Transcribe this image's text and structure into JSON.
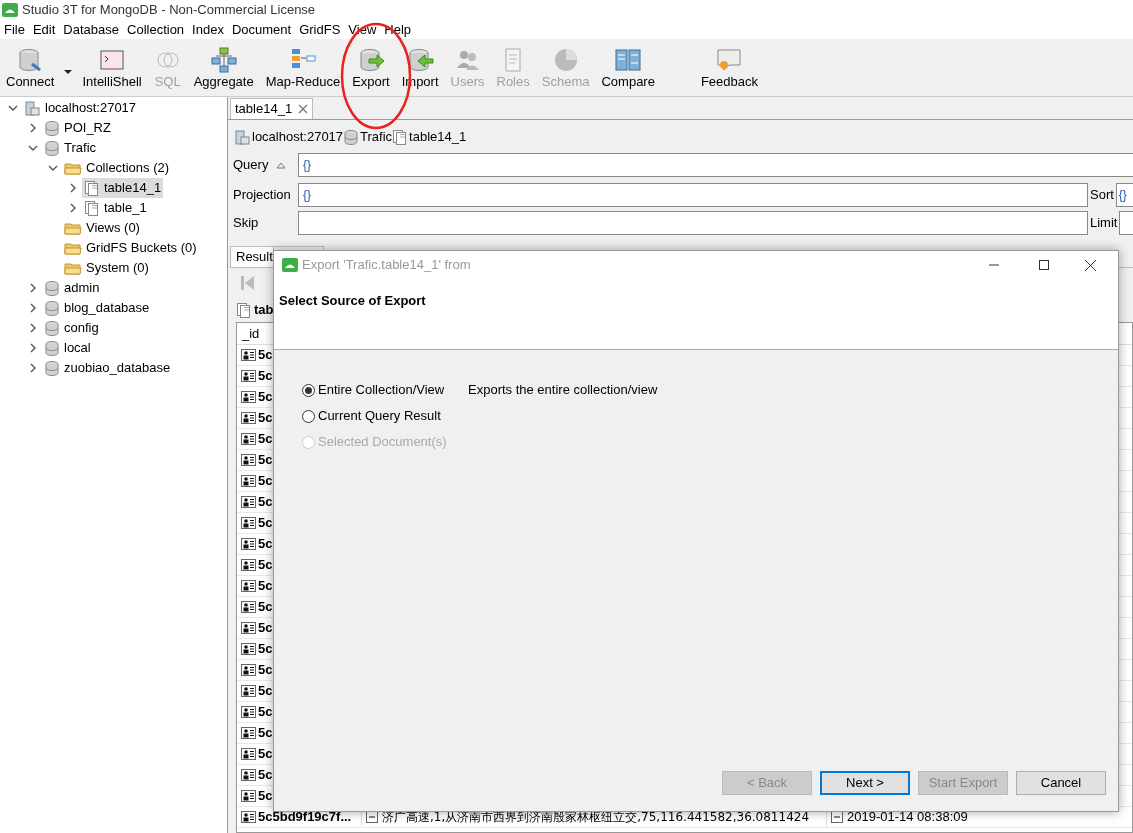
{
  "window": {
    "title": "Studio 3T for MongoDB - Non-Commercial License"
  },
  "menu": [
    "File",
    "Edit",
    "Database",
    "Collection",
    "Index",
    "Document",
    "GridFS",
    "View",
    "Help"
  ],
  "toolbar": [
    {
      "kind": "connect",
      "label": "Connect",
      "disabled": false,
      "dropdown": true
    },
    {
      "kind": "shell",
      "label": "IntelliShell",
      "disabled": false,
      "dropdown": false
    },
    {
      "kind": "sql",
      "label": "SQL",
      "disabled": true,
      "dropdown": false
    },
    {
      "kind": "aggregate",
      "label": "Aggregate",
      "disabled": false,
      "dropdown": false
    },
    {
      "kind": "mapreduce",
      "label": "Map-Reduce",
      "disabled": false,
      "dropdown": false
    },
    {
      "kind": "export",
      "label": "Export",
      "disabled": false,
      "dropdown": false
    },
    {
      "kind": "import",
      "label": "Import",
      "disabled": false,
      "dropdown": false
    },
    {
      "kind": "users",
      "label": "Users",
      "disabled": true,
      "dropdown": false
    },
    {
      "kind": "roles",
      "label": "Roles",
      "disabled": true,
      "dropdown": false
    },
    {
      "kind": "schema",
      "label": "Schema",
      "disabled": true,
      "dropdown": false
    },
    {
      "kind": "compare",
      "label": "Compare",
      "disabled": false,
      "dropdown": false
    },
    {
      "kind": "feedback",
      "label": "Feedback",
      "disabled": false,
      "dropdown": false
    }
  ],
  "tree": [
    {
      "kind": "server",
      "label": "localhost:27017",
      "expandable": true,
      "expanded": true,
      "selected": false,
      "children": [
        {
          "kind": "database",
          "label": "POI_RZ",
          "expandable": true,
          "expanded": false,
          "selected": false
        },
        {
          "kind": "database",
          "label": "Trafic",
          "expandable": true,
          "expanded": true,
          "selected": false,
          "children": [
            {
              "kind": "folder",
              "label": "Collections (2)",
              "expandable": true,
              "expanded": true,
              "selected": false,
              "children": [
                {
                  "kind": "collection",
                  "label": "table14_1",
                  "expandable": true,
                  "expanded": false,
                  "selected": true
                },
                {
                  "kind": "collection",
                  "label": "table_1",
                  "expandable": true,
                  "expanded": false,
                  "selected": false
                }
              ]
            },
            {
              "kind": "folder",
              "label": "Views (0)",
              "expandable": false,
              "selected": false
            },
            {
              "kind": "folder",
              "label": "GridFS Buckets (0)",
              "expandable": false,
              "selected": false
            },
            {
              "kind": "folder",
              "label": "System (0)",
              "expandable": false,
              "selected": false
            }
          ]
        },
        {
          "kind": "database",
          "label": "admin",
          "expandable": true,
          "expanded": false,
          "selected": false
        },
        {
          "kind": "database",
          "label": "blog_database",
          "expandable": true,
          "expanded": false,
          "selected": false
        },
        {
          "kind": "database",
          "label": "config",
          "expandable": true,
          "expanded": false,
          "selected": false
        },
        {
          "kind": "database",
          "label": "local",
          "expandable": true,
          "expanded": false,
          "selected": false
        },
        {
          "kind": "database",
          "label": "zuobiao_database",
          "expandable": true,
          "expanded": false,
          "selected": false
        }
      ]
    }
  ],
  "editor_tab": {
    "label": "table14_1"
  },
  "breadcrumb": [
    {
      "kind": "server",
      "label": "localhost:27017"
    },
    {
      "kind": "database",
      "label": "Trafic"
    },
    {
      "kind": "collection",
      "label": "table14_1"
    }
  ],
  "query": {
    "query_label": "Query",
    "query": "{}",
    "projection_label": "Projection",
    "projection": "{}",
    "sort_label": "Sort",
    "sort": "{}",
    "skip_label": "Skip",
    "limit_label": "Limit"
  },
  "result_tab": {
    "label": "Result"
  },
  "grid": {
    "collection": "tab",
    "columns": [
      "_id"
    ],
    "rows": [
      {
        "id": "5c"
      },
      {
        "id": "5c"
      },
      {
        "id": "5c"
      },
      {
        "id": "5c"
      },
      {
        "id": "5c"
      },
      {
        "id": "5c"
      },
      {
        "id": "5c"
      },
      {
        "id": "5c"
      },
      {
        "id": "5c"
      },
      {
        "id": "5c"
      },
      {
        "id": "5c"
      },
      {
        "id": "5c"
      },
      {
        "id": "5c"
      },
      {
        "id": "5c"
      },
      {
        "id": "5c"
      },
      {
        "id": "5c"
      },
      {
        "id": "5c"
      },
      {
        "id": "5c"
      },
      {
        "id": "5c"
      },
      {
        "id": "5c"
      },
      {
        "id": "5c"
      },
      {
        "id": "5c"
      },
      {
        "id": "5c5bd9f19c7f...",
        "column_2": "济广高速,1,从济南市西界到济南殷家林枢纽立交,75,116.441582,36.0811424",
        "column_3": "2019-01-14 08:38:09"
      }
    ]
  },
  "dialog": {
    "title": "Export 'Trafic.table14_1' from",
    "heading": "Select Source of Export",
    "options": [
      {
        "label": "Entire Collection/View",
        "selected": true,
        "disabled": false,
        "description": "Exports the entire collection/view"
      },
      {
        "label": "Current Query Result",
        "selected": false,
        "disabled": false
      },
      {
        "label": "Selected Document(s)",
        "selected": false,
        "disabled": true
      }
    ],
    "buttons": [
      {
        "label": "< Back",
        "disabled": true,
        "default": false
      },
      {
        "label": "Next >",
        "disabled": false,
        "default": true
      },
      {
        "label": "Start Export",
        "disabled": true,
        "default": false
      },
      {
        "label": "Cancel",
        "disabled": false,
        "default": false
      }
    ]
  }
}
